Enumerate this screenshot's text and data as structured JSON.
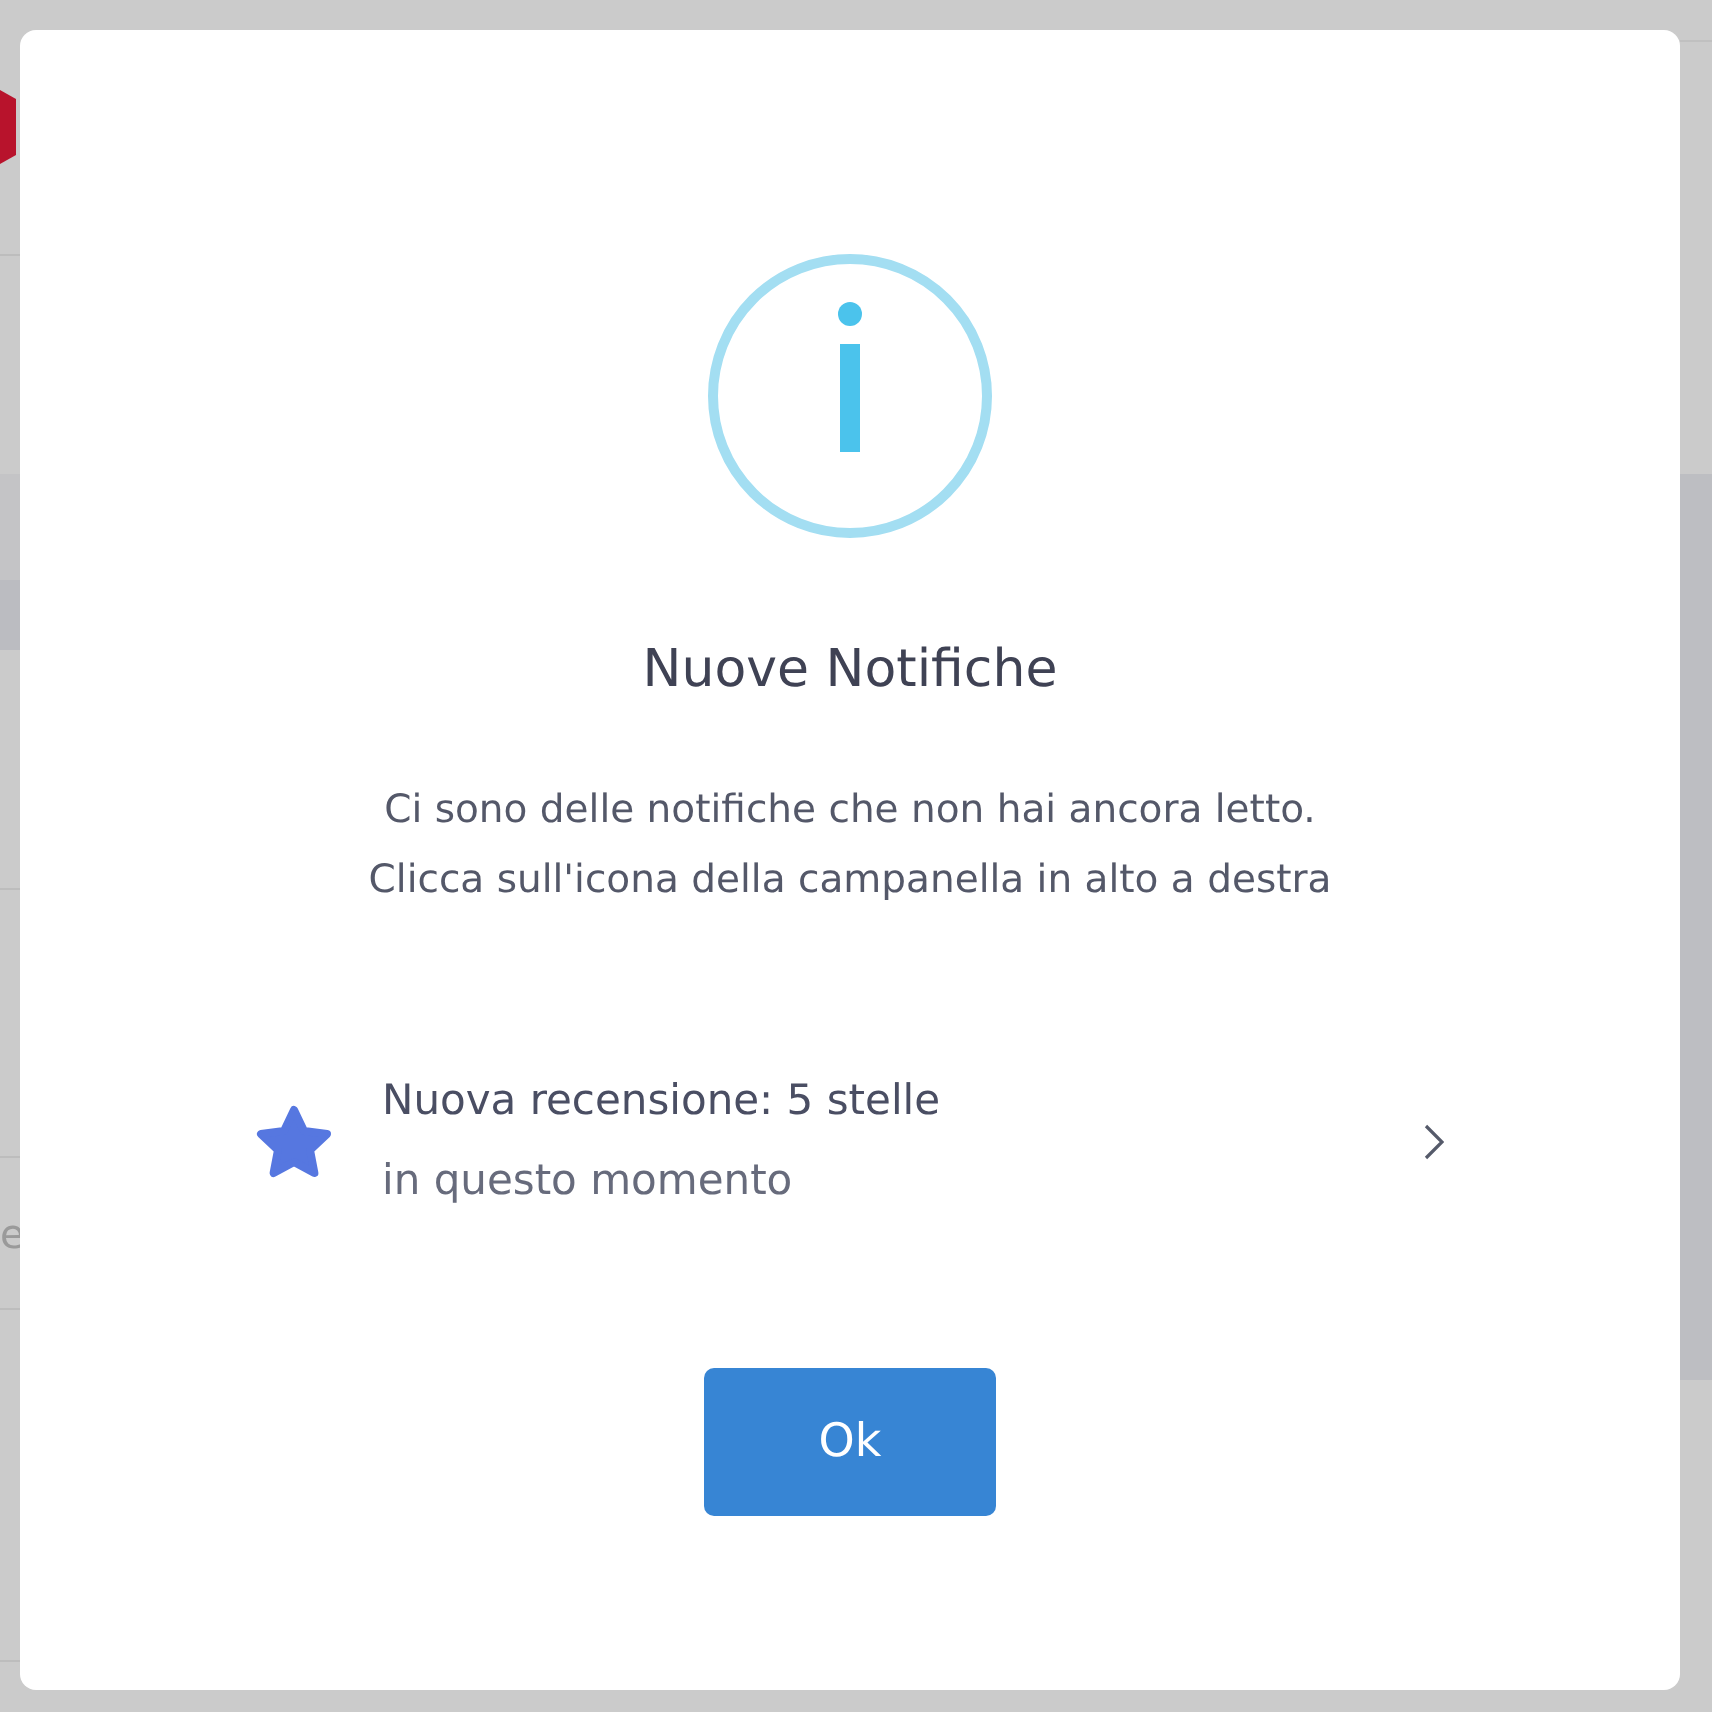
{
  "backdrop": {
    "field_text": "e"
  },
  "dialog": {
    "title": "Nuove Notifiche",
    "message_lines": [
      "Ci sono delle notifiche che non hai ancora letto.",
      "Clicca sull'icona della campanella in alto a destra"
    ],
    "notifications": [
      {
        "title": "Nuova recensione: 5 stelle",
        "time": "in questo momento"
      }
    ],
    "buttons": [
      {
        "label": "Ok"
      }
    ]
  }
}
